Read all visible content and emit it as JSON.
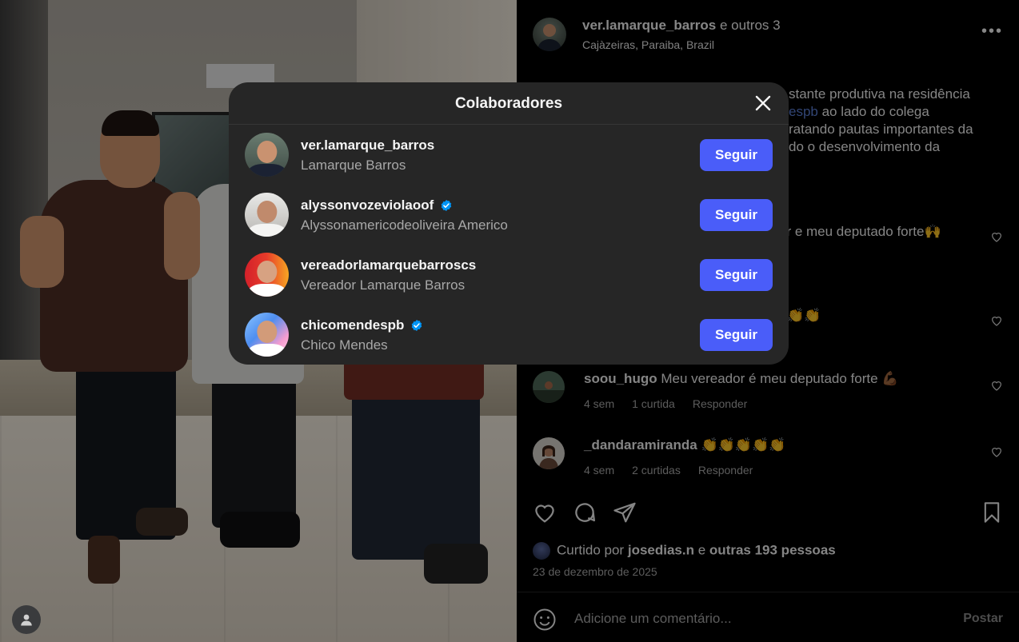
{
  "post": {
    "header": {
      "author": "ver.lamarque_barros",
      "and_others": "e outros 3",
      "location": "Cajàzeiras, Paraiba, Brazil",
      "more_icon": "more-horizontal-icon"
    },
    "caption_lines": [
      "stante produtiva na residência",
      "espb",
      " ao lado do colega",
      "ratando pautas importantes da",
      "do o desenvolvimento da"
    ],
    "partial_comments": [
      "or e meu deputado forte🙌",
      "👏👏"
    ],
    "comments": [
      {
        "user": "soou_hugo",
        "text": "Meu vereador é meu deputado forte 💪🏾",
        "time": "4 sem",
        "likes": "1 curtida",
        "reply": "Responder"
      },
      {
        "user": "_dandaramiranda",
        "text": "👏👏👏👏👏",
        "time": "4 sem",
        "likes": "2 curtidas",
        "reply": "Responder"
      }
    ],
    "liked_by": {
      "prefix": "Curtido por",
      "user": "josedias.n",
      "and": "e",
      "others": "outras 193 pessoas"
    },
    "date": "23 de dezembro de 2025",
    "comment_placeholder": "Adicione um comentário...",
    "post_button": "Postar"
  },
  "modal": {
    "title": "Colaboradores",
    "follow_label": "Seguir",
    "collaborators": [
      {
        "username": "ver.lamarque_barros",
        "name": "Lamarque Barros",
        "verified": false
      },
      {
        "username": "alyssonvozeviolaoof",
        "name": "Alyssonamericodeoliveira Americo",
        "verified": true
      },
      {
        "username": "vereadorlamarquebarroscs",
        "name": "Vereador Lamarque Barros",
        "verified": false
      },
      {
        "username": "chicomendespb",
        "name": "Chico Mendes",
        "verified": true
      }
    ]
  },
  "colors": {
    "accent": "#4a5df9",
    "verified": "#0095f6",
    "link": "#5b7fd6",
    "modal_bg": "#262626"
  }
}
